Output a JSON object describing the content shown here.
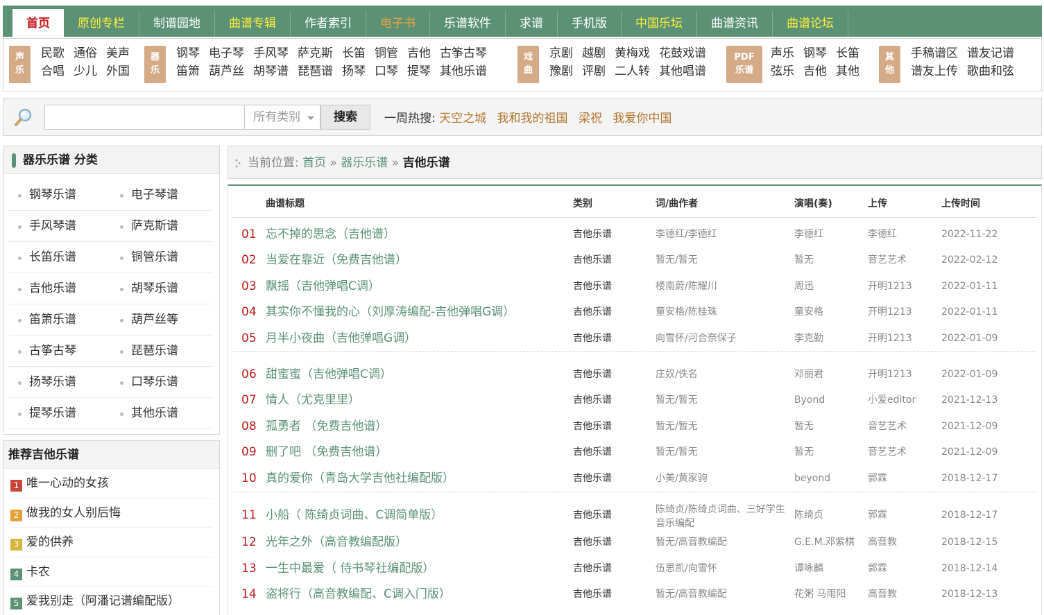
{
  "nav": [
    {
      "label": "首页",
      "state": "active"
    },
    {
      "label": "原创专栏",
      "state": "highlight"
    },
    {
      "label": "制谱园地",
      "state": "normal"
    },
    {
      "label": "曲谱专辑",
      "state": "highlight"
    },
    {
      "label": "作者索引",
      "state": "normal"
    },
    {
      "label": "电子书",
      "state": "highlight-orange"
    },
    {
      "label": "乐谱软件",
      "state": "normal"
    },
    {
      "label": "求谱",
      "state": "normal"
    },
    {
      "label": "手机版",
      "state": "normal"
    },
    {
      "label": "中国乐坛",
      "state": "highlight"
    },
    {
      "label": "曲谱资讯",
      "state": "normal"
    },
    {
      "label": "曲谱论坛",
      "state": "highlight"
    }
  ],
  "subnav": {
    "g1": {
      "badge1": "声",
      "badge2": "乐",
      "links": [
        "民歌",
        "合唱",
        "通俗",
        "少儿",
        "美声",
        "外国"
      ]
    },
    "g2": {
      "badge1": "器",
      "badge2": "乐",
      "links": [
        "钢琴",
        "笛箫",
        "电子琴",
        "葫芦丝",
        "手风琴",
        "胡琴谱",
        "萨克斯",
        "琵琶谱",
        "长笛",
        "扬琴",
        "铜管",
        "口琴",
        "吉他",
        "提琴",
        "古筝古琴",
        "其他乐谱"
      ]
    },
    "g3": {
      "badge1": "戏",
      "badge2": "曲",
      "links": [
        "京剧",
        "豫剧",
        "越剧",
        "评剧",
        "黄梅戏",
        "二人转",
        "花鼓戏谱",
        "其他唱谱"
      ]
    },
    "g4": {
      "badge1": "PDF",
      "badge2": "乐谱",
      "links": [
        "声乐",
        "弦乐",
        "钢琴",
        "吉他",
        "长笛",
        "其他"
      ]
    },
    "g5": {
      "badge1": "其",
      "badge2": "他",
      "links": [
        "手稿谱区",
        "谱友上传",
        "谱友记谱",
        "歌曲和弦"
      ]
    }
  },
  "search": {
    "input_value": "",
    "category": "所有类别",
    "button": "搜索",
    "hot_label": "一周热搜:",
    "hot_words": [
      "天空之城",
      "我和我的祖国",
      "梁祝",
      "我爱你中国"
    ]
  },
  "categories": {
    "title": "器乐乐谱 分类",
    "items": [
      "钢琴乐谱",
      "电子琴谱",
      "手风琴谱",
      "萨克斯谱",
      "长笛乐谱",
      "铜管乐谱",
      "吉他乐谱",
      "胡琴乐谱",
      "笛箫乐谱",
      "葫芦丝等",
      "古筝古琴",
      "琵琶乐谱",
      "扬琴乐谱",
      "口琴乐谱",
      "提琴乐谱",
      "其他乐谱"
    ]
  },
  "recommend": {
    "title": "推荐吉他乐谱",
    "items": [
      {
        "num": "1",
        "title": "唯一心动的女孩",
        "color": "#c9463d"
      },
      {
        "num": "2",
        "title": "做我的女人别后悔",
        "color": "#e4a23c"
      },
      {
        "num": "3",
        "title": "爱的供养",
        "color": "#d4b43a"
      },
      {
        "num": "4",
        "title": "卡农",
        "color": "#5b9276"
      },
      {
        "num": "5",
        "title": "爱我别走（阿潘记谱编配版）",
        "color": "#5b9276"
      }
    ]
  },
  "breadcrumb": {
    "prefix": "当前位置:",
    "home": "首页",
    "sep": "»",
    "level1": "器乐乐谱",
    "current": "吉他乐谱"
  },
  "table": {
    "headers": {
      "title": "曲谱标题",
      "category": "类别",
      "author": "词/曲作者",
      "performer": "演唱(奏)",
      "uploader": "上传",
      "date": "上传时间"
    },
    "rows": [
      {
        "num": "01",
        "title": "忘不掉的思念（吉他谱）",
        "category": "吉他乐谱",
        "author": "李德红/李德红",
        "performer": "李德红",
        "uploader": "李德红",
        "date": "2022-11-22"
      },
      {
        "num": "02",
        "title": "当爱在靠近（免费吉他谱）",
        "category": "吉他乐谱",
        "author": "暂无/暂无",
        "performer": "暂无",
        "uploader": "音艺艺术",
        "date": "2022-02-12"
      },
      {
        "num": "03",
        "title": "飘摇（吉他弹唱C调）",
        "category": "吉他乐谱",
        "author": "楼南蔚/陈耀川",
        "performer": "周迅",
        "uploader": "开明1213",
        "date": "2022-01-11"
      },
      {
        "num": "04",
        "title": "其实你不懂我的心（刘厚涛编配-吉他弹唱G调）",
        "category": "吉他乐谱",
        "author": "童安格/陈桂珠",
        "performer": "童安格",
        "uploader": "开明1213",
        "date": "2022-01-11"
      },
      {
        "num": "05",
        "title": "月半小夜曲（吉他弹唱G调）",
        "category": "吉他乐谱",
        "author": "向雪怀/河合奈保子",
        "performer": "李克勤",
        "uploader": "开明1213",
        "date": "2022-01-09"
      },
      {
        "num": "06",
        "title": "甜蜜蜜（吉他弹唱C调）",
        "category": "吉他乐谱",
        "author": "庄奴/佚名",
        "performer": "邓丽君",
        "uploader": "开明1213",
        "date": "2022-01-09"
      },
      {
        "num": "07",
        "title": "情人（尤克里里）",
        "category": "吉他乐谱",
        "author": "暂无/暂无",
        "performer": "Byond",
        "uploader": "小爱editor",
        "date": "2021-12-13"
      },
      {
        "num": "08",
        "title": "孤勇者 （免费吉他谱）",
        "category": "吉他乐谱",
        "author": "暂无/暂无",
        "performer": "暂无",
        "uploader": "音艺艺术",
        "date": "2021-12-09"
      },
      {
        "num": "09",
        "title": "删了吧 （免费吉他谱）",
        "category": "吉他乐谱",
        "author": "暂无/暂无",
        "performer": "暂无",
        "uploader": "音艺艺术",
        "date": "2021-12-09"
      },
      {
        "num": "10",
        "title": "真的爱你（青岛大学吉他社编配版）",
        "category": "吉他乐谱",
        "author": "小美/黄家驹",
        "performer": "beyond",
        "uploader": "郭霖",
        "date": "2018-12-17"
      },
      {
        "num": "11",
        "title": "小船（ 陈绮贞词曲、C调简单版）",
        "category": "吉他乐谱",
        "author": "陈绮贞/陈绮贞词曲、三好学生音乐编配",
        "performer": "陈绮贞",
        "uploader": "郭霖",
        "date": "2018-12-17"
      },
      {
        "num": "12",
        "title": "光年之外（高音教编配版）",
        "category": "吉他乐谱",
        "author": "暂无/高音教编配",
        "performer": "G.E.M.邓紫棋",
        "uploader": "高音教",
        "date": "2018-12-15"
      },
      {
        "num": "13",
        "title": "一生中最爱（ 侍书琴社编配版）",
        "category": "吉他乐谱",
        "author": "伍思凯/向雪怀",
        "performer": "谭咏麟",
        "uploader": "郭霖",
        "date": "2018-12-14"
      },
      {
        "num": "14",
        "title": "盗将行（高音教编配、C调入门版）",
        "category": "吉他乐谱",
        "author": "暂无/高音教编配",
        "performer": "花粥 马雨阳",
        "uploader": "高音教",
        "date": "2018-12-13"
      }
    ]
  }
}
